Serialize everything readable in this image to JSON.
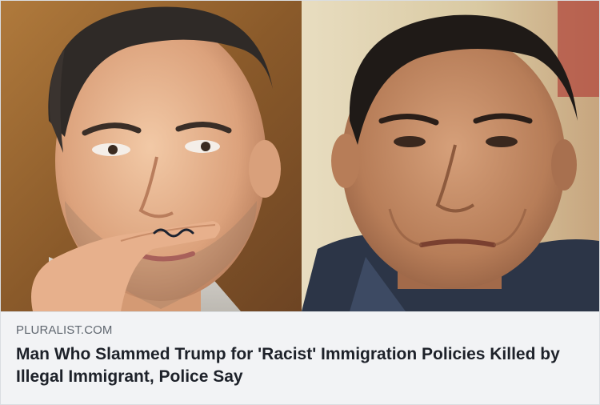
{
  "link_preview": {
    "images": [
      {
        "depiction": "man with finger held under nose as a drawn-on mustache"
      },
      {
        "depiction": "older man with dark hair facing camera"
      }
    ],
    "domain": "PLURALIST.COM",
    "headline": "Man Who Slammed Trump for 'Racist' Immigration Policies Killed by Illegal Immigrant, Police Say"
  },
  "colors": {
    "caption_background": "#f2f3f5",
    "domain_text": "#606770",
    "headline_text": "#1d2129",
    "border": "#dadde1"
  }
}
